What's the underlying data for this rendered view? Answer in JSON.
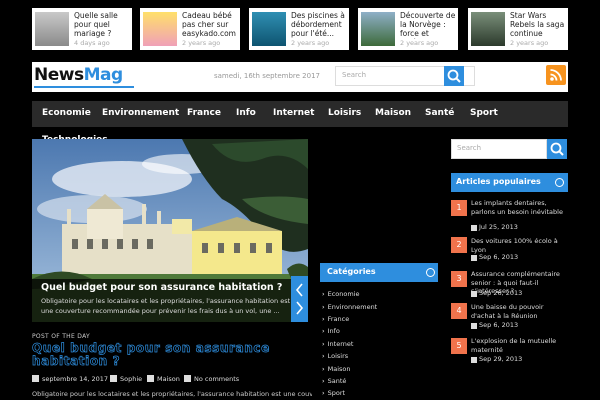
{
  "top_posts": [
    {
      "title": "Quelle salle pour quel mariage ?",
      "date": "4 days ago"
    },
    {
      "title": "Cadeau bébé pas cher sur easykado.com",
      "date": "2 years ago"
    },
    {
      "title": "Des piscines à débordement pour l'été...",
      "date": "2 years ago"
    },
    {
      "title": "Découverte de la Norvège : force et indépenda ..",
      "date": "2 years ago"
    },
    {
      "title": "Star Wars Rebels la saga continue",
      "date": "2 years ago"
    }
  ],
  "header": {
    "logo_news": "News",
    "logo_mag": "Mag",
    "date": "samedi, 16th septembre 2017",
    "search_placeholder": "Search"
  },
  "nav": [
    "Economie",
    "Environnement",
    "France",
    "Info",
    "Internet",
    "Loisirs",
    "Maison",
    "Santé",
    "Sport",
    "Technologies"
  ],
  "hero": {
    "title": "Quel budget pour son assurance habitation ?",
    "description": "Obligatoire pour les locataires et les propriétaires, l'assurance habitation est une couverture recommandée pour prévenir les frais dus à un vol, une ..."
  },
  "post_of_day": {
    "label": "POST OF THE DAY",
    "title": "Quel budget pour son assurance habitation ?",
    "date": "septembre 14, 2017",
    "author": "Sophie",
    "category": "Maison",
    "comments": "No comments",
    "excerpt": "Obligatoire pour les locataires et les propriétaires, l'assurance habitation est une couverture"
  },
  "categories": {
    "title": "Catégories",
    "items": [
      "Economie",
      "Environnement",
      "France",
      "Info",
      "Internet",
      "Loisirs",
      "Maison",
      "Santé",
      "Sport"
    ]
  },
  "sidebar": {
    "search_placeholder": "Search",
    "popular_title": "Articles populaires",
    "popular": [
      {
        "num": "1",
        "title": "Les implants dentaires, parlons un besoin inévitable",
        "date": "Jul 25, 2013"
      },
      {
        "num": "2",
        "title": "Des voitures 100% écolo à Lyon",
        "date": "Sep 6, 2013"
      },
      {
        "num": "3",
        "title": "Assurance complémentaire senior : à quoi faut-il s'intéresser ?",
        "date": "Sep 26, 2013"
      },
      {
        "num": "4",
        "title": "Une baisse du pouvoir d'achat à la Réunion",
        "date": "Sep 6, 2013"
      },
      {
        "num": "5",
        "title": "L'explosion de la mutuelle maternité",
        "date": "Sep 29, 2013"
      }
    ]
  },
  "colors": {
    "accent": "#2e8ede",
    "popular_number": "#f0734c",
    "rss": "#f7931e"
  }
}
